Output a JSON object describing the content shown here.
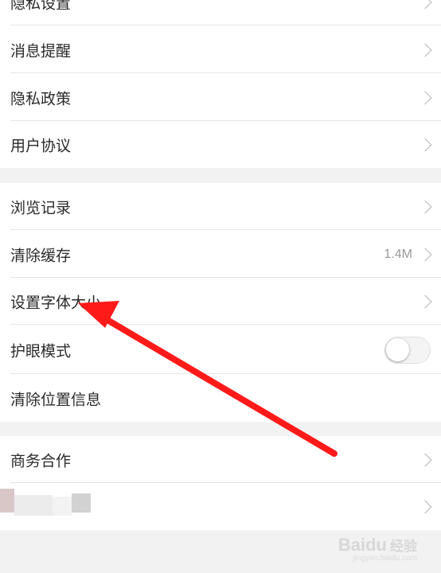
{
  "group1": {
    "items": [
      {
        "label": "隐私设置"
      },
      {
        "label": "消息提醒"
      },
      {
        "label": "隐私政策"
      },
      {
        "label": "用户协议"
      }
    ]
  },
  "group2": {
    "items": [
      {
        "label": "浏览记录"
      },
      {
        "label": "清除缓存",
        "value": "1.4M"
      },
      {
        "label": "设置字体大小"
      },
      {
        "label": "护眼模式",
        "toggle_on": false
      },
      {
        "label": "清除位置信息"
      }
    ]
  },
  "group3": {
    "items": [
      {
        "label": "商务合作"
      },
      {
        "label": ""
      }
    ]
  },
  "annotation": {
    "color": "#ff1a1a",
    "points_to": "设置字体大小"
  },
  "watermark": {
    "brand": "Baidu",
    "sub": "经验",
    "url": "jingyan.baidu.com"
  }
}
